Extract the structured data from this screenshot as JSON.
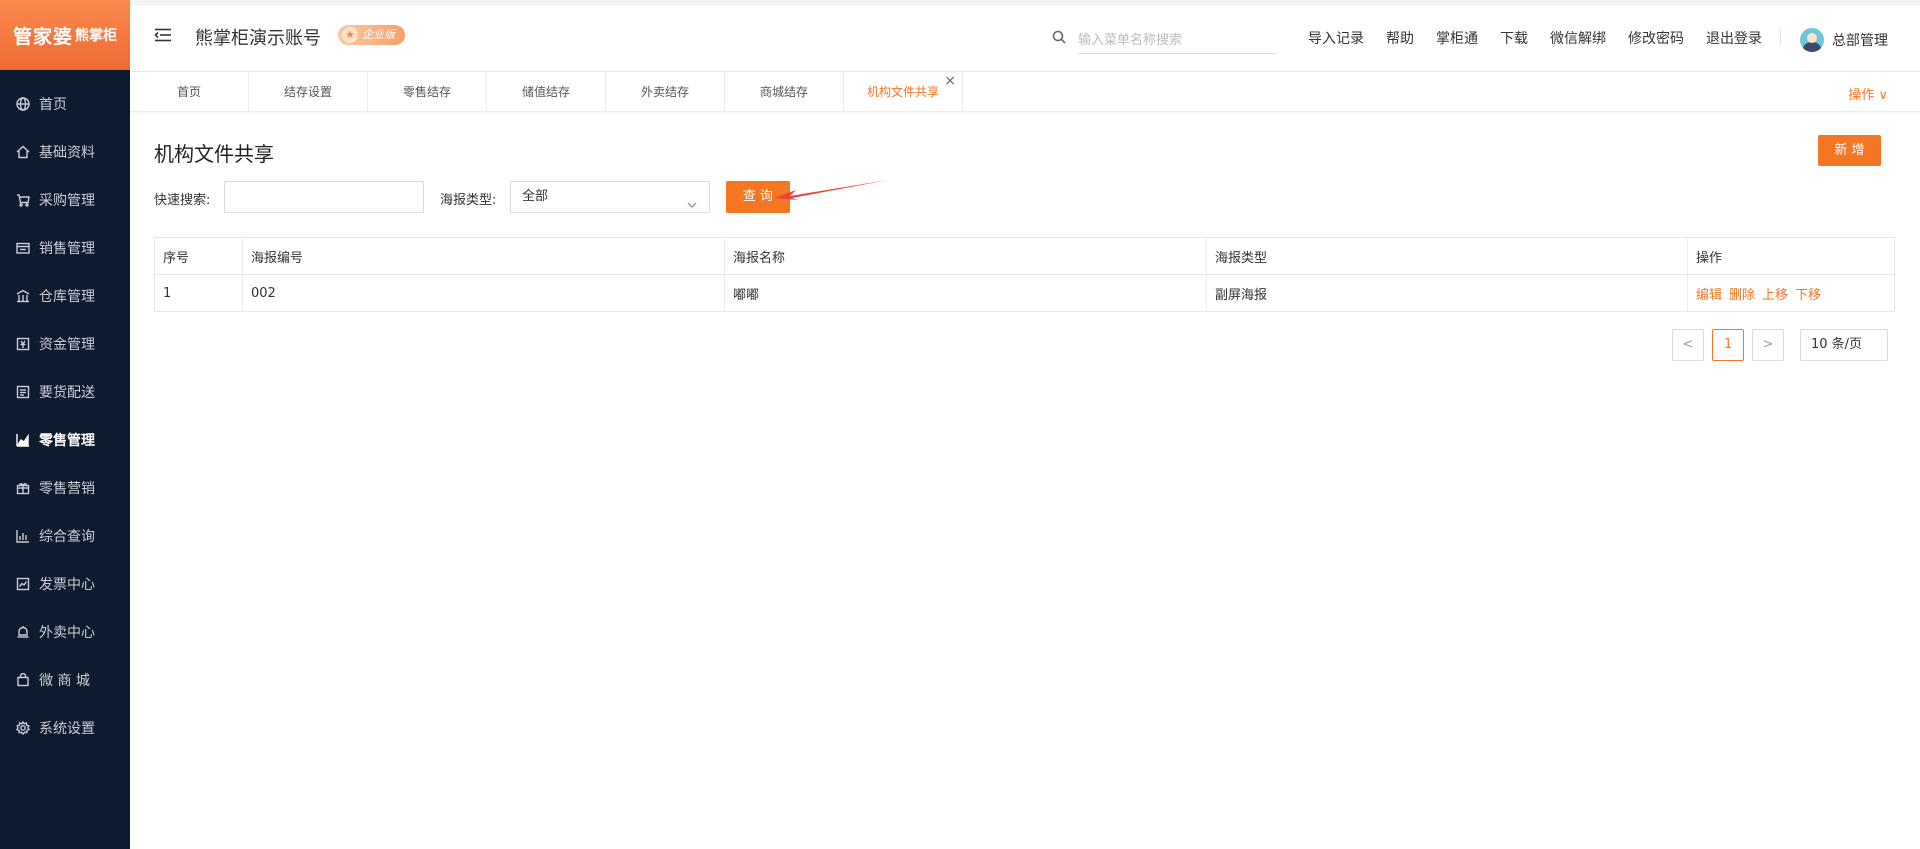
{
  "logo": {
    "brand": "管家婆",
    "sub": "熊掌柜"
  },
  "sidebar": {
    "items": [
      {
        "label": "首页",
        "icon": "globe-icon"
      },
      {
        "label": "基础资料",
        "icon": "home-icon"
      },
      {
        "label": "采购管理",
        "icon": "cart-icon"
      },
      {
        "label": "销售管理",
        "icon": "sales-icon"
      },
      {
        "label": "仓库管理",
        "icon": "warehouse-icon"
      },
      {
        "label": "资金管理",
        "icon": "wallet-icon"
      },
      {
        "label": "要货配送",
        "icon": "list-icon"
      },
      {
        "label": "零售管理",
        "icon": "chart-icon",
        "active": true
      },
      {
        "label": "零售营销",
        "icon": "gift-icon"
      },
      {
        "label": "综合查询",
        "icon": "bar-chart-icon"
      },
      {
        "label": "发票中心",
        "icon": "invoice-icon"
      },
      {
        "label": "外卖中心",
        "icon": "bell-icon"
      },
      {
        "label": "微 商 城",
        "icon": "bag-icon"
      },
      {
        "label": "系统设置",
        "icon": "gear-icon"
      }
    ]
  },
  "header": {
    "account": "熊掌柜演示账号",
    "edition_badge": "企业版",
    "search_placeholder": "输入菜单名称搜索",
    "links": [
      "导入记录",
      "帮助",
      "掌柜通",
      "下载",
      "微信解绑",
      "修改密码",
      "退出登录"
    ],
    "user": "总部管理"
  },
  "tabs": {
    "items": [
      "首页",
      "结存设置",
      "零售结存",
      "储值结存",
      "外卖结存",
      "商城结存",
      "机构文件共享"
    ],
    "active_index": 6,
    "operation": "操作 ∨"
  },
  "page": {
    "title": "机构文件共享",
    "add_button": "新 增",
    "quick_search_label": "快速搜索:",
    "quick_search_value": "",
    "poster_type_label": "海报类型:",
    "poster_type_value": "全部",
    "query_button": "查 询"
  },
  "table": {
    "headers": [
      "序号",
      "海报编号",
      "海报名称",
      "海报类型",
      "操作"
    ],
    "rows": [
      {
        "index": "1",
        "code": "002",
        "name": "嘟嘟",
        "type": "副屏海报",
        "actions": [
          "编辑",
          "删除",
          "上移",
          "下移"
        ]
      }
    ]
  },
  "pagination": {
    "prev": "<",
    "current": "1",
    "next": ">",
    "page_size": "10 条/页"
  },
  "colors": {
    "accent": "#f57622",
    "sidebar_bg": "#0e1a2e"
  }
}
